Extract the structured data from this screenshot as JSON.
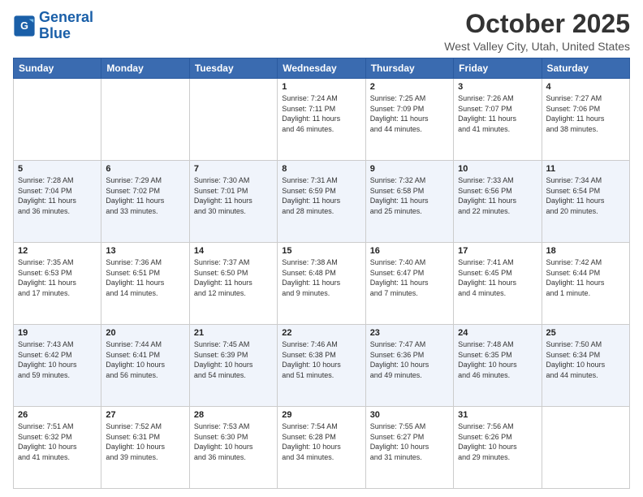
{
  "logo": {
    "line1": "General",
    "line2": "Blue"
  },
  "header": {
    "month": "October 2025",
    "location": "West Valley City, Utah, United States"
  },
  "days_of_week": [
    "Sunday",
    "Monday",
    "Tuesday",
    "Wednesday",
    "Thursday",
    "Friday",
    "Saturday"
  ],
  "weeks": [
    [
      {
        "day": "",
        "info": ""
      },
      {
        "day": "",
        "info": ""
      },
      {
        "day": "",
        "info": ""
      },
      {
        "day": "1",
        "info": "Sunrise: 7:24 AM\nSunset: 7:11 PM\nDaylight: 11 hours\nand 46 minutes."
      },
      {
        "day": "2",
        "info": "Sunrise: 7:25 AM\nSunset: 7:09 PM\nDaylight: 11 hours\nand 44 minutes."
      },
      {
        "day": "3",
        "info": "Sunrise: 7:26 AM\nSunset: 7:07 PM\nDaylight: 11 hours\nand 41 minutes."
      },
      {
        "day": "4",
        "info": "Sunrise: 7:27 AM\nSunset: 7:06 PM\nDaylight: 11 hours\nand 38 minutes."
      }
    ],
    [
      {
        "day": "5",
        "info": "Sunrise: 7:28 AM\nSunset: 7:04 PM\nDaylight: 11 hours\nand 36 minutes."
      },
      {
        "day": "6",
        "info": "Sunrise: 7:29 AM\nSunset: 7:02 PM\nDaylight: 11 hours\nand 33 minutes."
      },
      {
        "day": "7",
        "info": "Sunrise: 7:30 AM\nSunset: 7:01 PM\nDaylight: 11 hours\nand 30 minutes."
      },
      {
        "day": "8",
        "info": "Sunrise: 7:31 AM\nSunset: 6:59 PM\nDaylight: 11 hours\nand 28 minutes."
      },
      {
        "day": "9",
        "info": "Sunrise: 7:32 AM\nSunset: 6:58 PM\nDaylight: 11 hours\nand 25 minutes."
      },
      {
        "day": "10",
        "info": "Sunrise: 7:33 AM\nSunset: 6:56 PM\nDaylight: 11 hours\nand 22 minutes."
      },
      {
        "day": "11",
        "info": "Sunrise: 7:34 AM\nSunset: 6:54 PM\nDaylight: 11 hours\nand 20 minutes."
      }
    ],
    [
      {
        "day": "12",
        "info": "Sunrise: 7:35 AM\nSunset: 6:53 PM\nDaylight: 11 hours\nand 17 minutes."
      },
      {
        "day": "13",
        "info": "Sunrise: 7:36 AM\nSunset: 6:51 PM\nDaylight: 11 hours\nand 14 minutes."
      },
      {
        "day": "14",
        "info": "Sunrise: 7:37 AM\nSunset: 6:50 PM\nDaylight: 11 hours\nand 12 minutes."
      },
      {
        "day": "15",
        "info": "Sunrise: 7:38 AM\nSunset: 6:48 PM\nDaylight: 11 hours\nand 9 minutes."
      },
      {
        "day": "16",
        "info": "Sunrise: 7:40 AM\nSunset: 6:47 PM\nDaylight: 11 hours\nand 7 minutes."
      },
      {
        "day": "17",
        "info": "Sunrise: 7:41 AM\nSunset: 6:45 PM\nDaylight: 11 hours\nand 4 minutes."
      },
      {
        "day": "18",
        "info": "Sunrise: 7:42 AM\nSunset: 6:44 PM\nDaylight: 11 hours\nand 1 minute."
      }
    ],
    [
      {
        "day": "19",
        "info": "Sunrise: 7:43 AM\nSunset: 6:42 PM\nDaylight: 10 hours\nand 59 minutes."
      },
      {
        "day": "20",
        "info": "Sunrise: 7:44 AM\nSunset: 6:41 PM\nDaylight: 10 hours\nand 56 minutes."
      },
      {
        "day": "21",
        "info": "Sunrise: 7:45 AM\nSunset: 6:39 PM\nDaylight: 10 hours\nand 54 minutes."
      },
      {
        "day": "22",
        "info": "Sunrise: 7:46 AM\nSunset: 6:38 PM\nDaylight: 10 hours\nand 51 minutes."
      },
      {
        "day": "23",
        "info": "Sunrise: 7:47 AM\nSunset: 6:36 PM\nDaylight: 10 hours\nand 49 minutes."
      },
      {
        "day": "24",
        "info": "Sunrise: 7:48 AM\nSunset: 6:35 PM\nDaylight: 10 hours\nand 46 minutes."
      },
      {
        "day": "25",
        "info": "Sunrise: 7:50 AM\nSunset: 6:34 PM\nDaylight: 10 hours\nand 44 minutes."
      }
    ],
    [
      {
        "day": "26",
        "info": "Sunrise: 7:51 AM\nSunset: 6:32 PM\nDaylight: 10 hours\nand 41 minutes."
      },
      {
        "day": "27",
        "info": "Sunrise: 7:52 AM\nSunset: 6:31 PM\nDaylight: 10 hours\nand 39 minutes."
      },
      {
        "day": "28",
        "info": "Sunrise: 7:53 AM\nSunset: 6:30 PM\nDaylight: 10 hours\nand 36 minutes."
      },
      {
        "day": "29",
        "info": "Sunrise: 7:54 AM\nSunset: 6:28 PM\nDaylight: 10 hours\nand 34 minutes."
      },
      {
        "day": "30",
        "info": "Sunrise: 7:55 AM\nSunset: 6:27 PM\nDaylight: 10 hours\nand 31 minutes."
      },
      {
        "day": "31",
        "info": "Sunrise: 7:56 AM\nSunset: 6:26 PM\nDaylight: 10 hours\nand 29 minutes."
      },
      {
        "day": "",
        "info": ""
      }
    ]
  ]
}
